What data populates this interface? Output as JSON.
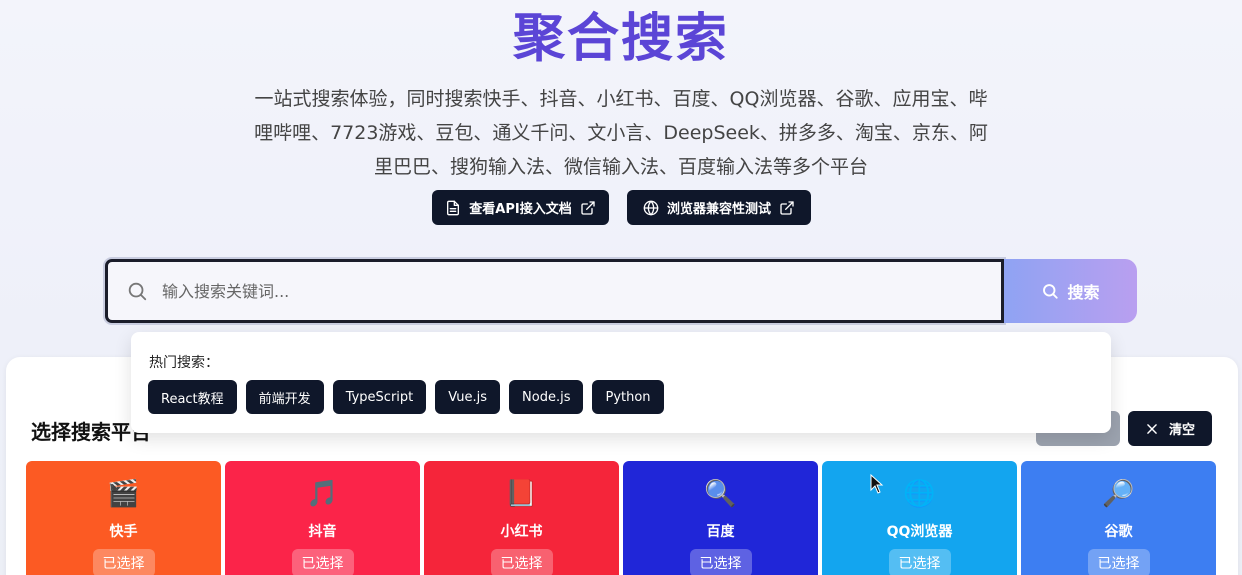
{
  "hero": {
    "title": "聚合搜索",
    "description": "一站式搜索体验，同时搜索快手、抖音、小红书、百度、QQ浏览器、谷歌、应用宝、哔哩哔哩、7723游戏、豆包、通义千问、文小言、DeepSeek、拼多多、淘宝、京东、阿里巴巴、搜狗输入法、微信输入法、百度输入法等多个平台",
    "api_doc_label": "查看API接入文档",
    "compat_test_label": "浏览器兼容性测试"
  },
  "search": {
    "placeholder": "输入搜索关键词...",
    "button_label": "搜索"
  },
  "hot_search": {
    "label": "热门搜索：",
    "tags": [
      "React教程",
      "前端开发",
      "TypeScript",
      "Vue.js",
      "Node.js",
      "Python"
    ]
  },
  "platforms_panel": {
    "title": "选择搜索平台",
    "clear_label": "清空"
  },
  "platforms": [
    {
      "name": "快手",
      "icon": "🎬",
      "icon_name": "clapper-icon",
      "status": "已选择",
      "color": "#fc5a23"
    },
    {
      "name": "抖音",
      "icon": "🎵",
      "icon_name": "music-note-icon",
      "status": "已选择",
      "color": "#fb2449"
    },
    {
      "name": "小红书",
      "icon": "📕",
      "icon_name": "red-book-icon",
      "status": "已选择",
      "color": "#f5253a"
    },
    {
      "name": "百度",
      "icon": "🔍",
      "icon_name": "magnifier-icon",
      "status": "已选择",
      "color": "#2026d8"
    },
    {
      "name": "QQ浏览器",
      "icon": "🌐",
      "icon_name": "globe-icon",
      "status": "已选择",
      "color": "#13a5ef"
    },
    {
      "name": "谷歌",
      "icon": "🔎",
      "icon_name": "magnifier-right-icon",
      "status": "已选择",
      "color": "#3d7ef2"
    }
  ]
}
